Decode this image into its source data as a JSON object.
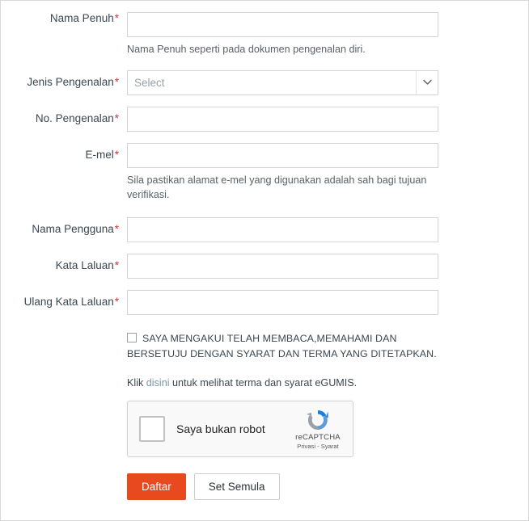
{
  "form": {
    "fields": [
      {
        "id": "nama-penuh",
        "label": "Nama Penuh",
        "required_mark": "*",
        "type": "text",
        "value": "",
        "help": "Nama Penuh seperti pada dokumen pengenalan diri."
      },
      {
        "id": "jenis-pengenalan",
        "label": "Jenis Pengenalan",
        "required_mark": "*",
        "type": "select",
        "value": "Select",
        "help": ""
      },
      {
        "id": "no-pengenalan",
        "label": "No. Pengenalan",
        "required_mark": "*",
        "type": "text",
        "value": "",
        "help": ""
      },
      {
        "id": "e-mel",
        "label": "E-mel",
        "required_mark": "*",
        "type": "text",
        "value": "",
        "help": "Sila pastikan alamat e-mel yang digunakan adalah sah bagi tujuan verifikasi."
      },
      {
        "id": "nama-pengguna",
        "label": "Nama Pengguna",
        "required_mark": "*",
        "type": "text",
        "value": "",
        "help": ""
      },
      {
        "id": "kata-laluan",
        "label": "Kata Laluan",
        "required_mark": "*",
        "type": "password",
        "value": "",
        "help": ""
      },
      {
        "id": "ulang-kata-laluan",
        "label": "Ulang Kata Laluan",
        "required_mark": "*",
        "type": "password",
        "value": "",
        "help": ""
      }
    ],
    "terms": {
      "checkbox_checked": false,
      "text_line1": "SAYA MENGAKUI TELAH MEMBACA,MEMAHAMI DAN",
      "text_line2": "BERSETUJU DENGAN SYARAT DAN TERMA YANG DITETAPKAN."
    },
    "terms_link": {
      "prefix": "Klik ",
      "link_text": "disini",
      "suffix": " untuk melihat terma dan syarat eGUMIS.",
      "link_color": "#7b96ad"
    },
    "recaptcha": {
      "checkbox_checked": false,
      "label": "Saya bukan robot",
      "brand": "reCAPTCHA",
      "legal": "Privasi - Syarat",
      "logo_blue": "#1c7fe0",
      "logo_gray": "#9aa0a6"
    },
    "buttons": {
      "submit_label": "Daftar",
      "submit_color": "#e8491f",
      "reset_label": "Set Semula"
    }
  }
}
